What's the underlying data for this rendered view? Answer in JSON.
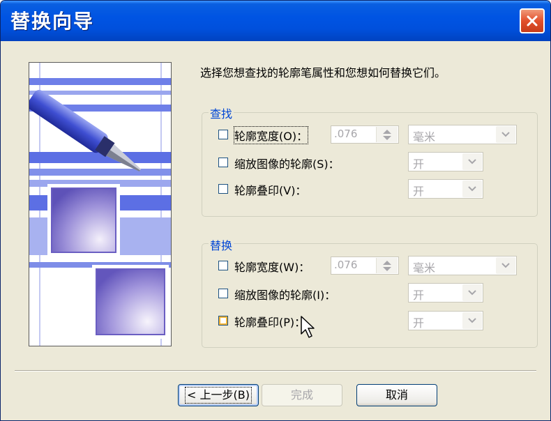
{
  "window": {
    "title": "替换向导"
  },
  "instruction": "选择您想查找的轮廓笔属性和您想如何替换它们。",
  "find": {
    "title": "查找",
    "outline_width": {
      "label": "轮廓宽度(O)：",
      "value": ".076",
      "unit": "毫米"
    },
    "scale_outline": {
      "label": "缩放图像的轮廓(S)：",
      "value": "开"
    },
    "overprint": {
      "label": "轮廓叠印(V)：",
      "value": "开"
    }
  },
  "replace": {
    "title": "替换",
    "outline_width": {
      "label": "轮廓宽度(W)：",
      "value": ".076",
      "unit": "毫米"
    },
    "scale_outline": {
      "label": "缩放图像的轮廓(I)：",
      "value": "开"
    },
    "overprint": {
      "label": "轮廓叠印(P)：",
      "value": "开"
    }
  },
  "buttons": {
    "back": "< 上一步(B)",
    "finish": "完成",
    "cancel": "取消"
  },
  "colors": {
    "title_bar": "#0054e3",
    "group_title": "#0046d5",
    "face": "#ece9d8"
  }
}
